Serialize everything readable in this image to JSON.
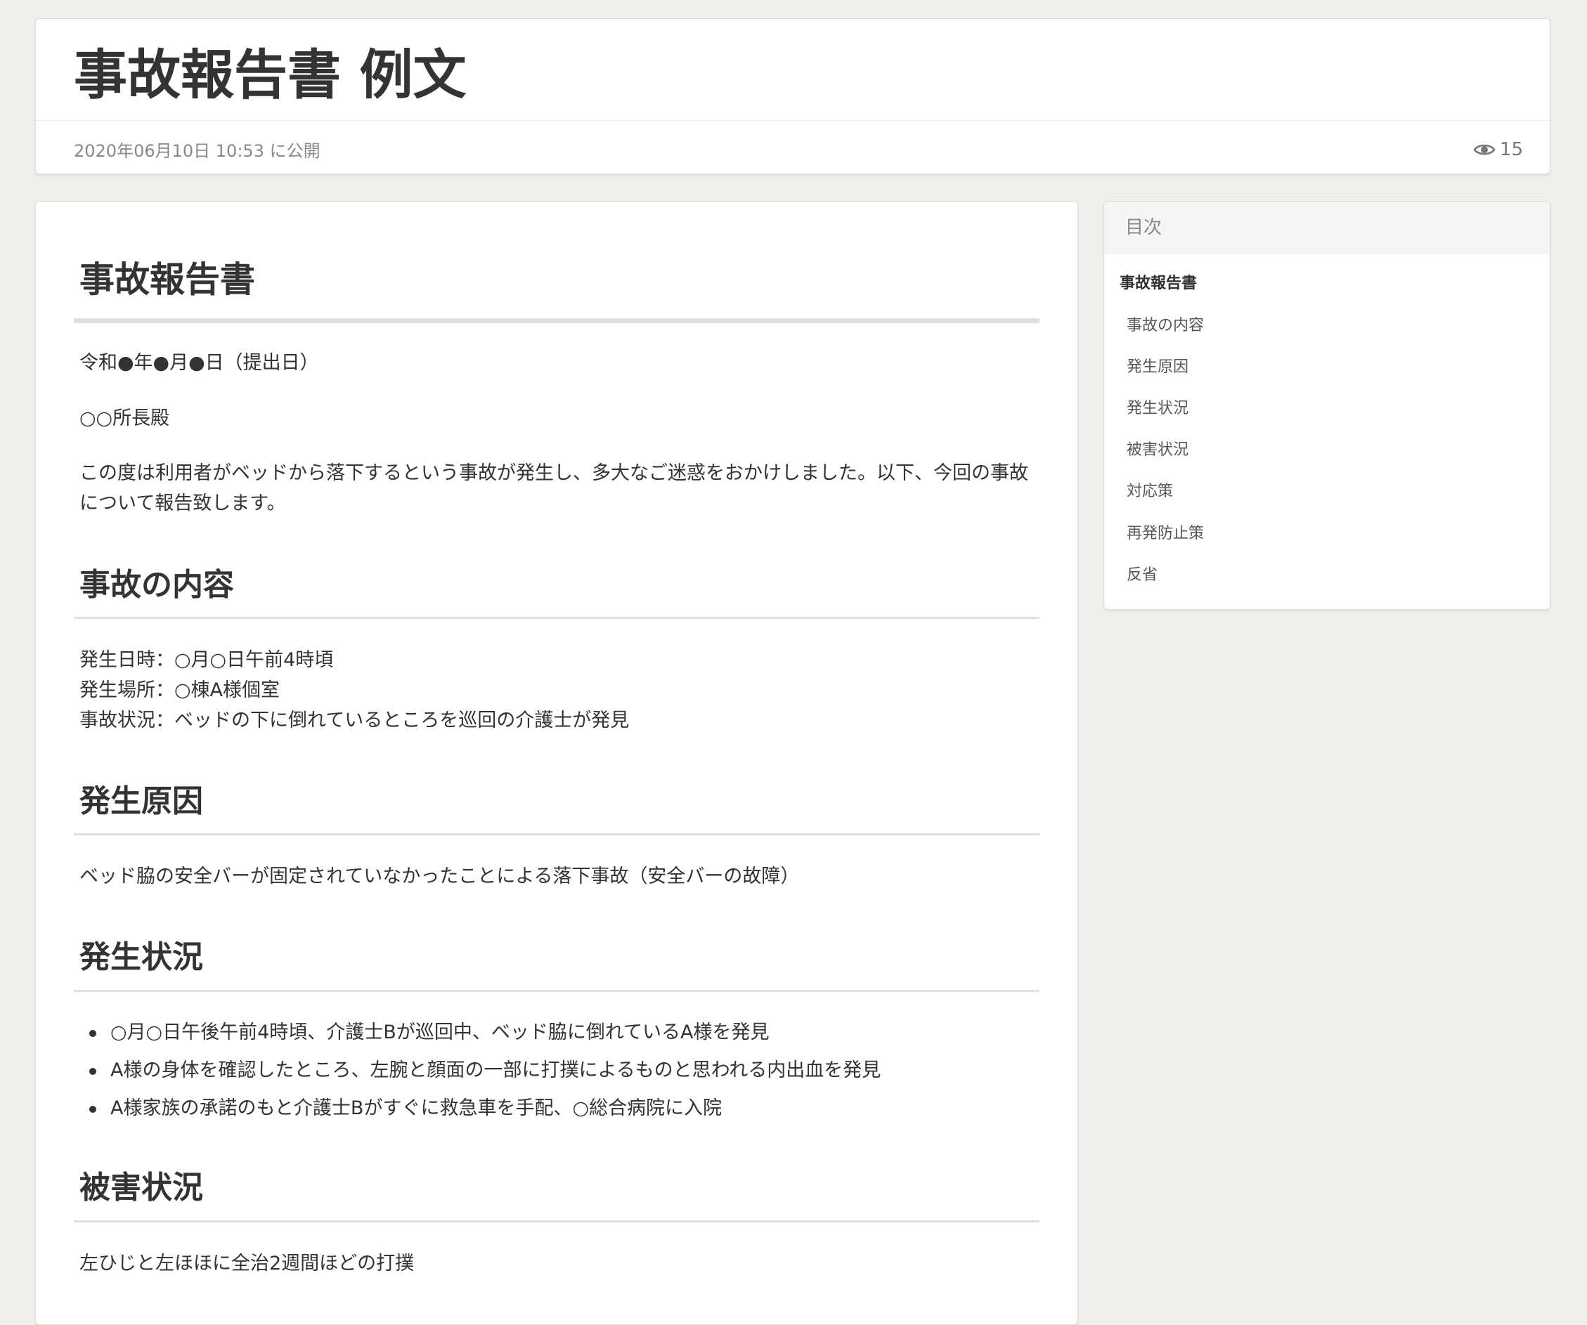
{
  "header": {
    "title": "事故報告書 例文",
    "published": "2020年06月10日 10:53 に公開",
    "views": "15",
    "views_icon": "eye-icon"
  },
  "article": {
    "h1": "事故報告書",
    "date_line": "令和●年●月●日（提出日）",
    "addressee": "○○所長殿",
    "intro": "この度は利用者がベッドから落下するという事故が発生し、多大なご迷惑をおかけしました。以下、今回の事故について報告致します。",
    "sections": [
      {
        "heading": "事故の内容",
        "lines": [
          "発生日時：○月○日午前4時頃",
          "発生場所：○棟A様個室",
          "事故状況：ベッドの下に倒れているところを巡回の介護士が発見"
        ]
      },
      {
        "heading": "発生原因",
        "lines": [
          "ベッド脇の安全バーが固定されていなかったことによる落下事故（安全バーの故障）"
        ]
      },
      {
        "heading": "発生状況",
        "items": [
          "○月○日午後午前4時頃、介護士Bが巡回中、ベッド脇に倒れているA様を発見",
          "A様の身体を確認したところ、左腕と顔面の一部に打撲によるものと思われる内出血を発見",
          "A様家族の承諾のもと介護士Bがすぐに救急車を手配、○総合病院に入院"
        ]
      },
      {
        "heading": "被害状況",
        "lines": [
          "左ひじと左ほほに全治2週間ほどの打撲"
        ]
      }
    ]
  },
  "toc": {
    "title": "目次",
    "items": [
      "事故報告書",
      "事故の内容",
      "発生原因",
      "発生状況",
      "被害状況",
      "対応策",
      "再発防止策",
      "反省"
    ]
  }
}
